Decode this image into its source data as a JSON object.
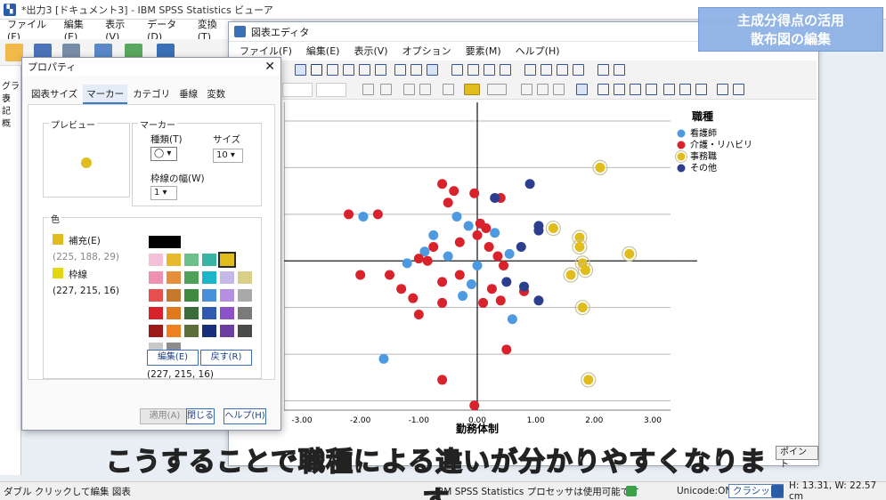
{
  "main_window": {
    "title": "*出力3 [ドキュメント3] - IBM SPSS Statistics ビューア",
    "menu": [
      "ファイル(F)",
      "編集(E)",
      "表示(V)",
      "データ(D)",
      "変換(T)"
    ],
    "tree_items": [
      "グラフ",
      "表",
      "記",
      "概"
    ]
  },
  "chart_editor": {
    "title": "図表エディタ",
    "menu": [
      "ファイル(F)",
      "編集(E)",
      "表示(V)",
      "オプション",
      "要素(M)",
      "ヘルプ(H)"
    ],
    "ok_fragment": "ポイント"
  },
  "dialog": {
    "title": "プロパティ",
    "tabs": [
      "図表サイズ",
      "マーカー",
      "カテゴリ",
      "垂線",
      "変数"
    ],
    "active_tab": "マーカー",
    "preview_label": "プレビュー",
    "marker_group_label": "マーカー",
    "type_label": "種類(T)",
    "size_label": "サイズ",
    "size_value": "10",
    "border_width_label": "枠線の幅(W)",
    "border_width_value": "1",
    "color_group_label": "色",
    "fill_label": "補充(E)",
    "fill_rgb": "(225, 188, 29)",
    "border_label": "枠線",
    "border_rgb": "(227, 215, 16)",
    "edit_button": "編集(E)",
    "reset_button": "戻す(R)",
    "selected_rgb": "(227, 215, 16)",
    "apply_button": "適用(A)",
    "close_button": "閉じる",
    "help_button": "ヘルプ(H)",
    "fill_color": "#e1bc1d",
    "border_color": "#e3d710",
    "palette": [
      [
        "#000000",
        "#000000",
        "#ffffff",
        "#ffffff",
        "#ffffff",
        "#ffffff"
      ],
      [
        "#f4c2d8",
        "#e8b830",
        "#6dc08a",
        "#38b3a4",
        "#e1bc1d",
        "#ffffff"
      ],
      [
        "#ef8fb1",
        "#e58f3b",
        "#4fa05a",
        "#1cb5c8",
        "#c4b8e6",
        "#d8cf8a"
      ],
      [
        "#e85050",
        "#c6782d",
        "#3e8a3e",
        "#4a90d8",
        "#b690e0",
        "#a9a9a9"
      ],
      [
        "#d8222c",
        "#e07a1e",
        "#3b6b3b",
        "#3059b0",
        "#8a54c8",
        "#7a7a7a"
      ],
      [
        "#9e1a1a",
        "#f08020",
        "#5b6e3b",
        "#1a2f7a",
        "#6a3fa0",
        "#4a4a4a"
      ],
      [
        "#c8c8c8",
        "#8c8c8c",
        "#ffffff",
        "#ffffff",
        "#ffffff",
        "#ffffff"
      ]
    ]
  },
  "status_bar": {
    "left": "ダブル クリックして編集 図表",
    "processor": "IBM SPSS Statistics プロセッサは使用可能です",
    "unicode": "Unicode:ON",
    "mode": "クラシック",
    "size": "H: 13.31, W: 22.57 cm"
  },
  "overlay": {
    "badge_line1": "主成分得点の活用",
    "badge_line2": "散布図の編集",
    "subtitle": "こうすることで職種による違いが分かりやすくなります"
  },
  "chart_data": {
    "type": "scatter",
    "xlabel": "勤務体制",
    "ylabel": "",
    "xlim": [
      -3.0,
      3.0
    ],
    "x_ticks": [
      "-3.00",
      "-2.00",
      "-1.00",
      "0.00",
      "1.00",
      "2.00",
      "3.00"
    ],
    "legend_title": "職種",
    "legend_position": "top-right",
    "grid": true,
    "series": [
      {
        "name": "看護師",
        "color": "#4e9ae0",
        "points": [
          [
            -1.95,
            0.95
          ],
          [
            -0.75,
            0.55
          ],
          [
            -0.9,
            0.2
          ],
          [
            -1.2,
            -0.05
          ],
          [
            -0.5,
            0.1
          ],
          [
            -0.15,
            0.75
          ],
          [
            -0.35,
            0.95
          ],
          [
            0.55,
            0.15
          ],
          [
            0.0,
            -0.1
          ],
          [
            -0.25,
            -0.75
          ],
          [
            0.6,
            -1.25
          ],
          [
            -1.6,
            -2.1
          ],
          [
            -0.1,
            -0.5
          ],
          [
            0.3,
            0.6
          ]
        ]
      },
      {
        "name": "介護・リハビリ",
        "color": "#d8222c",
        "points": [
          [
            -2.2,
            1.0
          ],
          [
            -1.7,
            1.0
          ],
          [
            -0.6,
            1.65
          ],
          [
            -0.5,
            1.25
          ],
          [
            -0.4,
            1.5
          ],
          [
            -0.05,
            1.45
          ],
          [
            0.4,
            1.35
          ],
          [
            0.15,
            0.7
          ],
          [
            0.05,
            0.8
          ],
          [
            0.0,
            0.55
          ],
          [
            -0.3,
            0.4
          ],
          [
            -0.75,
            0.3
          ],
          [
            -1.0,
            0.05
          ],
          [
            -0.85,
            0.0
          ],
          [
            -2.0,
            -0.3
          ],
          [
            -1.5,
            -0.3
          ],
          [
            -1.3,
            -0.6
          ],
          [
            -1.1,
            -0.8
          ],
          [
            -0.6,
            -0.45
          ],
          [
            -0.3,
            -0.3
          ],
          [
            0.2,
            0.3
          ],
          [
            0.35,
            0.1
          ],
          [
            0.45,
            -0.1
          ],
          [
            0.25,
            -0.6
          ],
          [
            0.1,
            -0.9
          ],
          [
            0.4,
            -0.85
          ],
          [
            0.8,
            -0.65
          ],
          [
            -1.0,
            -1.15
          ],
          [
            -0.6,
            -0.9
          ],
          [
            0.5,
            -1.9
          ],
          [
            -0.6,
            -2.55
          ],
          [
            -0.05,
            -3.1
          ]
        ]
      },
      {
        "name": "事務職",
        "color": "#e1bc1d",
        "points": [
          [
            2.1,
            2.0
          ],
          [
            1.3,
            0.7
          ],
          [
            1.75,
            0.5
          ],
          [
            1.75,
            0.3
          ],
          [
            2.6,
            0.15
          ],
          [
            1.8,
            -0.05
          ],
          [
            1.85,
            -0.2
          ],
          [
            1.6,
            -0.3
          ],
          [
            1.8,
            -1.0
          ],
          [
            1.9,
            -2.55
          ]
        ]
      },
      {
        "name": "その他",
        "color": "#2c3f8e",
        "points": [
          [
            0.9,
            1.65
          ],
          [
            0.3,
            1.35
          ],
          [
            1.05,
            0.75
          ],
          [
            1.05,
            0.65
          ],
          [
            0.75,
            0.3
          ],
          [
            0.5,
            -0.45
          ],
          [
            0.8,
            -0.55
          ],
          [
            1.05,
            -0.85
          ]
        ]
      }
    ]
  }
}
